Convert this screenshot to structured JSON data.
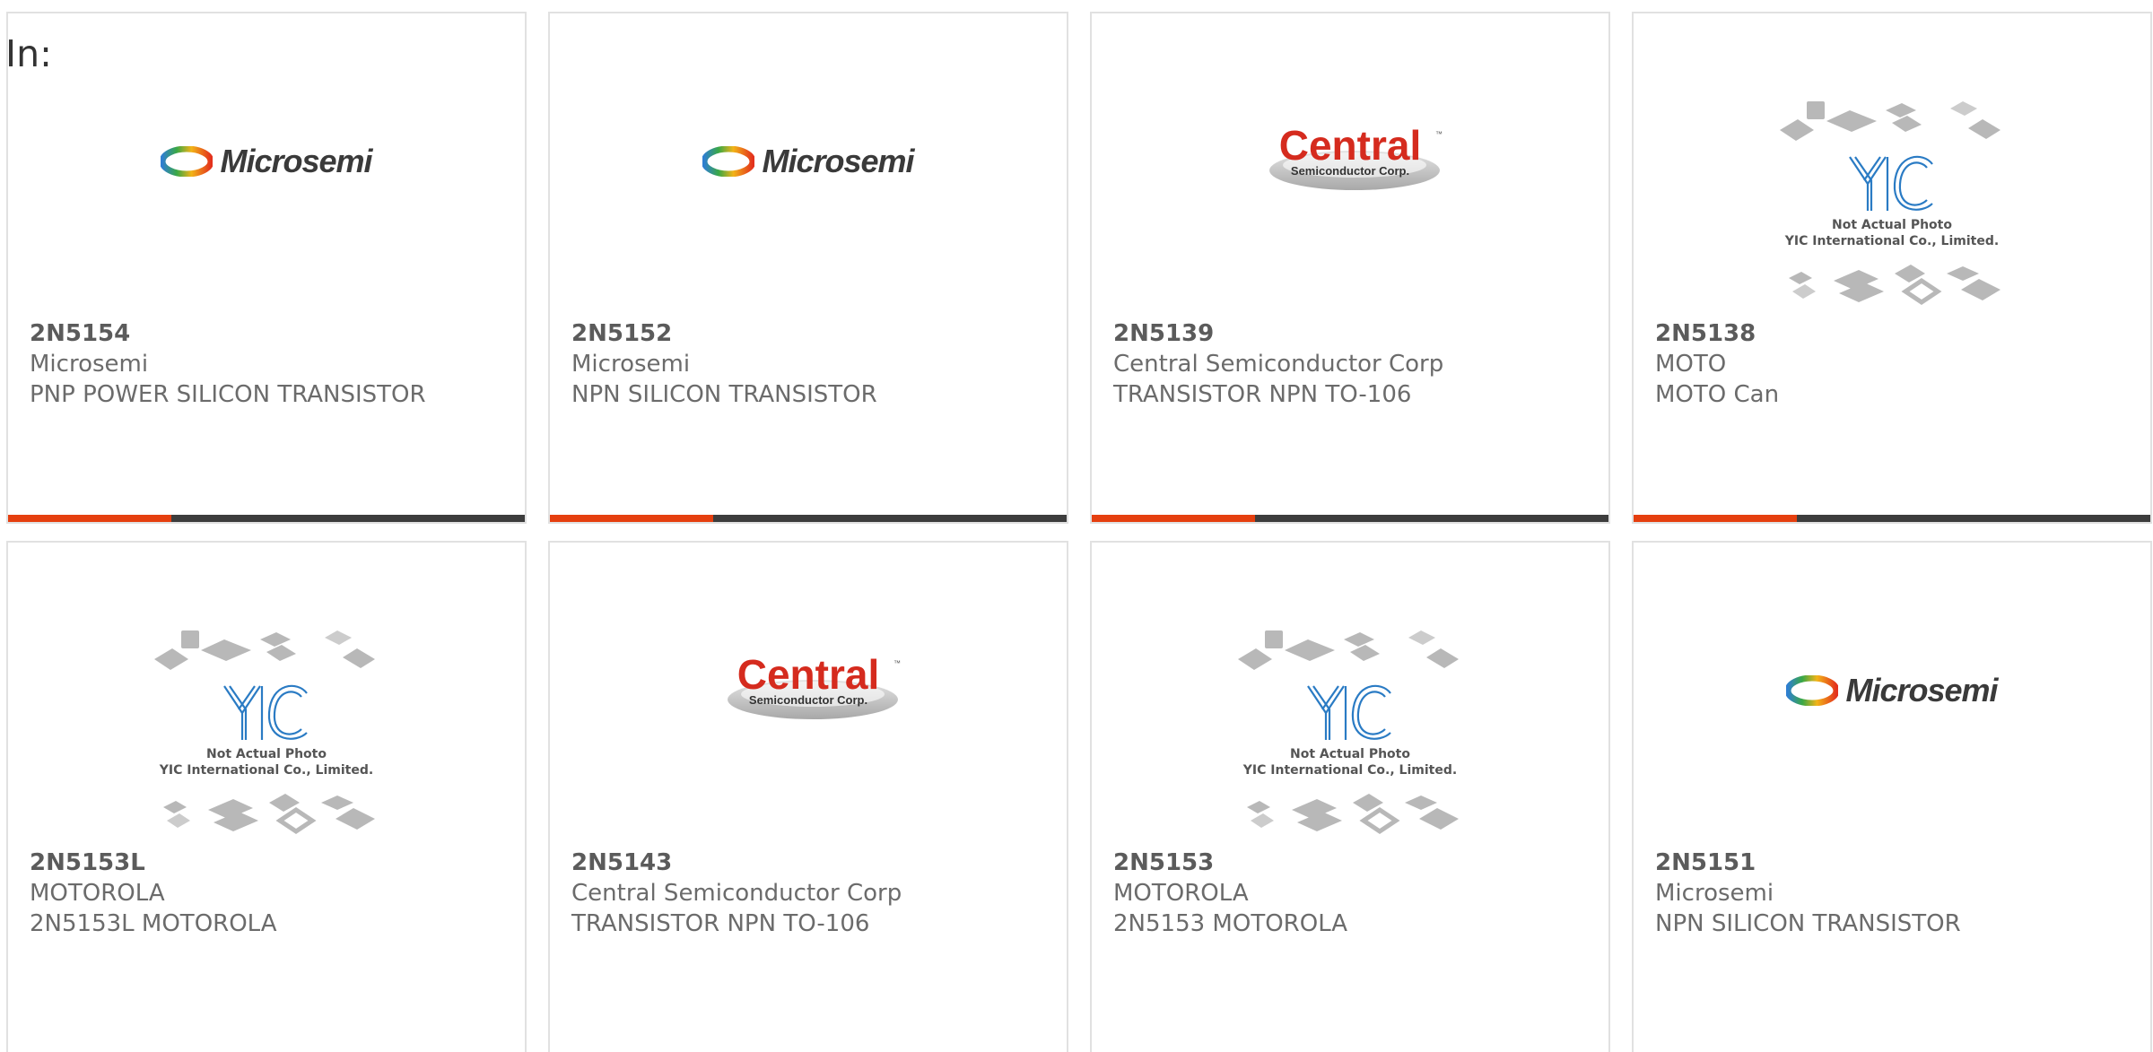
{
  "header": {
    "in_label": "In:"
  },
  "colors": {
    "accent": "#e53f0f",
    "bar": "#3d3d3d",
    "border": "#e1e1e1",
    "text": "#6b6b6b"
  },
  "products": [
    {
      "part": "2N5154",
      "maker": "Microsemi",
      "desc": "PNP POWER SILICON TRANSISTOR",
      "logo": "microsemi-logo",
      "logo_text": "Microsemi"
    },
    {
      "part": "2N5152",
      "maker": "Microsemi",
      "desc": "NPN SILICON TRANSISTOR",
      "logo": "microsemi-logo",
      "logo_text": "Microsemi"
    },
    {
      "part": "2N5139",
      "maker": "Central Semiconductor Corp",
      "desc": "TRANSISTOR NPN TO-106",
      "logo": "central-logo",
      "logo_text": "Central",
      "logo_sub": "Semiconductor Corp."
    },
    {
      "part": "2N5138",
      "maker": "MOTO",
      "desc": "MOTO Can",
      "logo": "yic-placeholder",
      "logo_text": "Not Actual Photo",
      "logo_sub": "YIC International Co., Limited."
    },
    {
      "part": "2N5153L",
      "maker": "MOTOROLA",
      "desc": "2N5153L MOTOROLA",
      "logo": "yic-placeholder",
      "logo_text": "Not Actual Photo",
      "logo_sub": "YIC International Co., Limited."
    },
    {
      "part": "2N5143",
      "maker": "Central Semiconductor Corp",
      "desc": "TRANSISTOR NPN TO-106",
      "logo": "central-logo",
      "logo_text": "Central",
      "logo_sub": "Semiconductor Corp."
    },
    {
      "part": "2N5153",
      "maker": "MOTOROLA",
      "desc": "2N5153 MOTOROLA",
      "logo": "yic-placeholder",
      "logo_text": "Not Actual Photo",
      "logo_sub": "YIC International Co., Limited."
    },
    {
      "part": "2N5151",
      "maker": "Microsemi",
      "desc": "NPN SILICON TRANSISTOR",
      "logo": "microsemi-logo",
      "logo_text": "Microsemi"
    }
  ]
}
